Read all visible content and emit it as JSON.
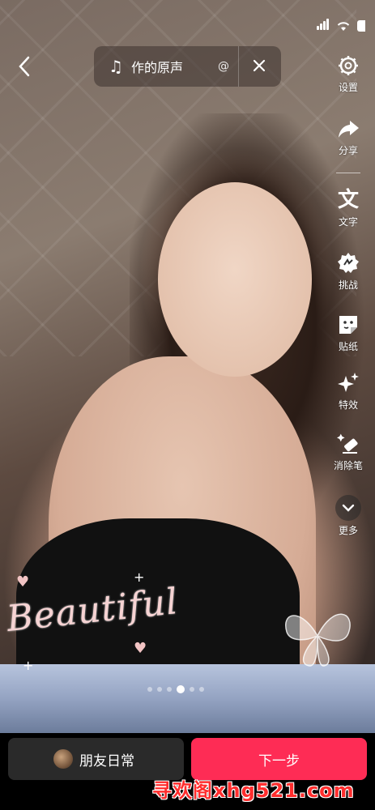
{
  "music": {
    "note_icon": "music-note-icon",
    "title": "作的原声",
    "at_symbol": "@",
    "close_icon": "close-icon"
  },
  "tools": [
    {
      "key": "settings",
      "label": "设置",
      "icon": "gear-icon"
    },
    {
      "key": "share",
      "label": "分享",
      "icon": "share-arrow-icon"
    },
    {
      "key": "text",
      "label": "文字",
      "icon": "text-icon",
      "glyph": "文"
    },
    {
      "key": "challenge",
      "label": "挑战",
      "icon": "challenge-icon"
    },
    {
      "key": "sticker",
      "label": "贴纸",
      "icon": "sticker-icon"
    },
    {
      "key": "effects",
      "label": "特效",
      "icon": "sparkle-icon"
    },
    {
      "key": "eraser",
      "label": "消除笔",
      "icon": "eraser-icon"
    },
    {
      "key": "more",
      "label": "更多",
      "icon": "chevron-down-icon"
    }
  ],
  "overlay": {
    "sticker_text": "Beautiful"
  },
  "pager": {
    "count": 6,
    "active_index": 3
  },
  "bottom": {
    "daily_label": "朋友日常",
    "next_label": "下一步"
  },
  "watermark": {
    "text": "寻欢阁xhg521.com"
  }
}
